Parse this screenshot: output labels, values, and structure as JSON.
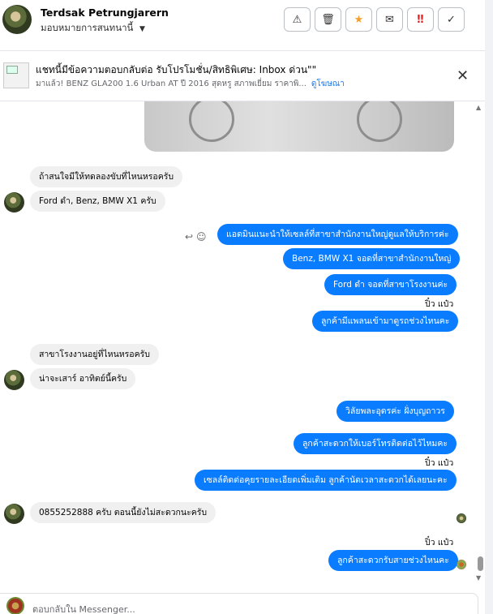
{
  "header": {
    "name": "Terdsak Petrungjarern",
    "assign_label": "มอบหมายการสนทนานี้",
    "caret": "▼",
    "actions": [
      {
        "icon": "warning-icon",
        "glyph": "⚠"
      },
      {
        "icon": "trash-icon",
        "glyph": "🗑"
      },
      {
        "icon": "star-icon",
        "glyph": "★"
      },
      {
        "icon": "mail-icon",
        "glyph": "✉"
      },
      {
        "icon": "flag-icon",
        "glyph": "‼"
      },
      {
        "icon": "check-icon",
        "glyph": "✓"
      }
    ]
  },
  "banner": {
    "title": "แชทนี้มีข้อความตอบกลับต่อ รับโปรโมชั่น/สิทธิพิเศษ: Inbox ด่วน\"\"",
    "subtitle": "มาแล้ว! BENZ GLA200 1.6 Urban AT ปี 2016 สุดหรู สภาพเยี่ยม ราคาพิ...",
    "link": "ดูโฆษณา",
    "close": "✕"
  },
  "messages": {
    "m1": "ถ้าสนใจมีให้ทดลองขับที่ไหนหรอครับ",
    "m2": "Ford ดำ, Benz, BMW X1 ครับ",
    "m3": "แอดมินแนะนำให้เซลล์ที่สาขาสำนักงานใหญ่ดูแลให้บริการค่ะ",
    "m4": "Benz, BMW X1 จอดที่สาขาสำนักงานใหญ่",
    "m5": "Ford ดำ  จอดที่สาขาโรงงานค่ะ",
    "seen1": "ปิ๋ว แป๋ว",
    "m6": "ลูกค้ามีแพลนเข้ามาดูรถช่วงไหนคะ",
    "m7": "สาขาโรงงานอยู่ที่ไหนหรอครับ",
    "m8": "น่าจะเสาร์ อาทิตย์นี้ครับ",
    "m9": "วิลัยพละอุดรค่ะ  ฝั่งบุญถาวร",
    "m10": "ลูกค้าสะดวกให้เบอร์โทรติดต่อไว้ไหมคะ",
    "seen2": "ปิ๋ว แป๋ว",
    "m11": "เซลล์ติดต่อคุยรายละเอียดเพิ่มเติม ลูกค้านัดเวลาสะดวกได้เลยนะคะ",
    "m12": "0855252888 ครับ ตอนนี้ยังไม่สะดวกนะครับ",
    "seen3": "ปิ๋ว แป๋ว",
    "m13": "ลูกค้าสะดวกรับสายช่วงไหนคะ"
  },
  "reply": {
    "placeholder": "ตอบกลับใน Messenger..."
  },
  "colors": {
    "outgoing": "#0a7cff",
    "incoming": "#f0f0f0",
    "link": "#1877f2"
  }
}
